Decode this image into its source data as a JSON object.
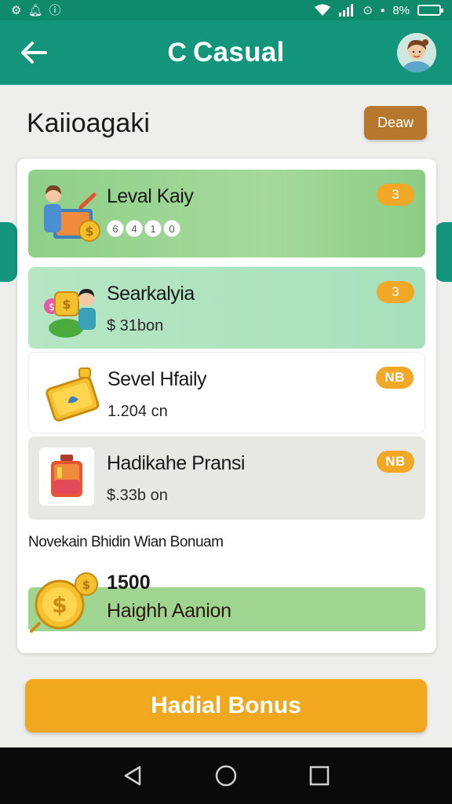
{
  "status_bar": {
    "left_icons": [
      "settings-icon",
      "notification-icon",
      "info-icon"
    ],
    "battery_text": "8%"
  },
  "app_bar": {
    "title": "Casual",
    "title_icon": "C"
  },
  "header": {
    "title": "Kaiioagaki",
    "view_button": "Deaw"
  },
  "list": {
    "items": [
      {
        "title": "Leval Kaiy",
        "sub_icons": [
          "6",
          "4",
          "1",
          "0"
        ],
        "badge": "3",
        "icon": "gift-box-icon"
      },
      {
        "title": "Searkalyia",
        "subtitle": "$ 31bon",
        "badge": "3",
        "icon": "money-bag-icon"
      },
      {
        "title": "Sevel Hfaily",
        "subtitle": "1.204 cn",
        "badge": "NB",
        "icon": "ticket-icon"
      },
      {
        "title": "Hadikahe Pransi",
        "subtitle": "$.33b on",
        "badge": "NB",
        "icon": "jar-icon"
      }
    ]
  },
  "reward": {
    "section_label": "Novekain Bhidin Wian Bonuam",
    "amount": "1500",
    "label": "Haighh Aanion"
  },
  "bonus_button": {
    "label": "Hadial Bonus"
  },
  "colors": {
    "primary": "#12957a",
    "accent": "#f1a81f",
    "view_button": "#b7782e"
  }
}
